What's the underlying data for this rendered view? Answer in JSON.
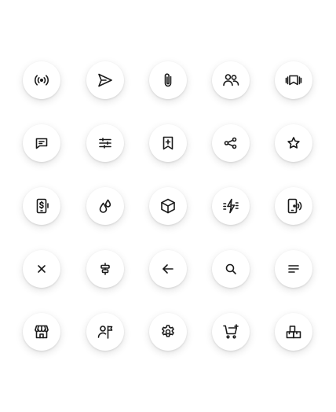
{
  "icons": [
    [
      "broadcast-icon",
      "send-icon",
      "paperclip-icon",
      "users-icon",
      "carousel-icon"
    ],
    [
      "message-icon",
      "sliders-icon",
      "bookmark-add-icon",
      "share-icon",
      "star-icon"
    ],
    [
      "mobile-payment-icon",
      "droplets-icon",
      "box-icon",
      "flash-off-icon",
      "phone-signal-icon"
    ],
    [
      "close-icon",
      "align-center-icon",
      "arrow-left-icon",
      "search-icon",
      "menu-lines-icon"
    ],
    [
      "storefront-icon",
      "user-flag-icon",
      "gear-icon",
      "cart-add-icon",
      "boxes-icon"
    ]
  ]
}
